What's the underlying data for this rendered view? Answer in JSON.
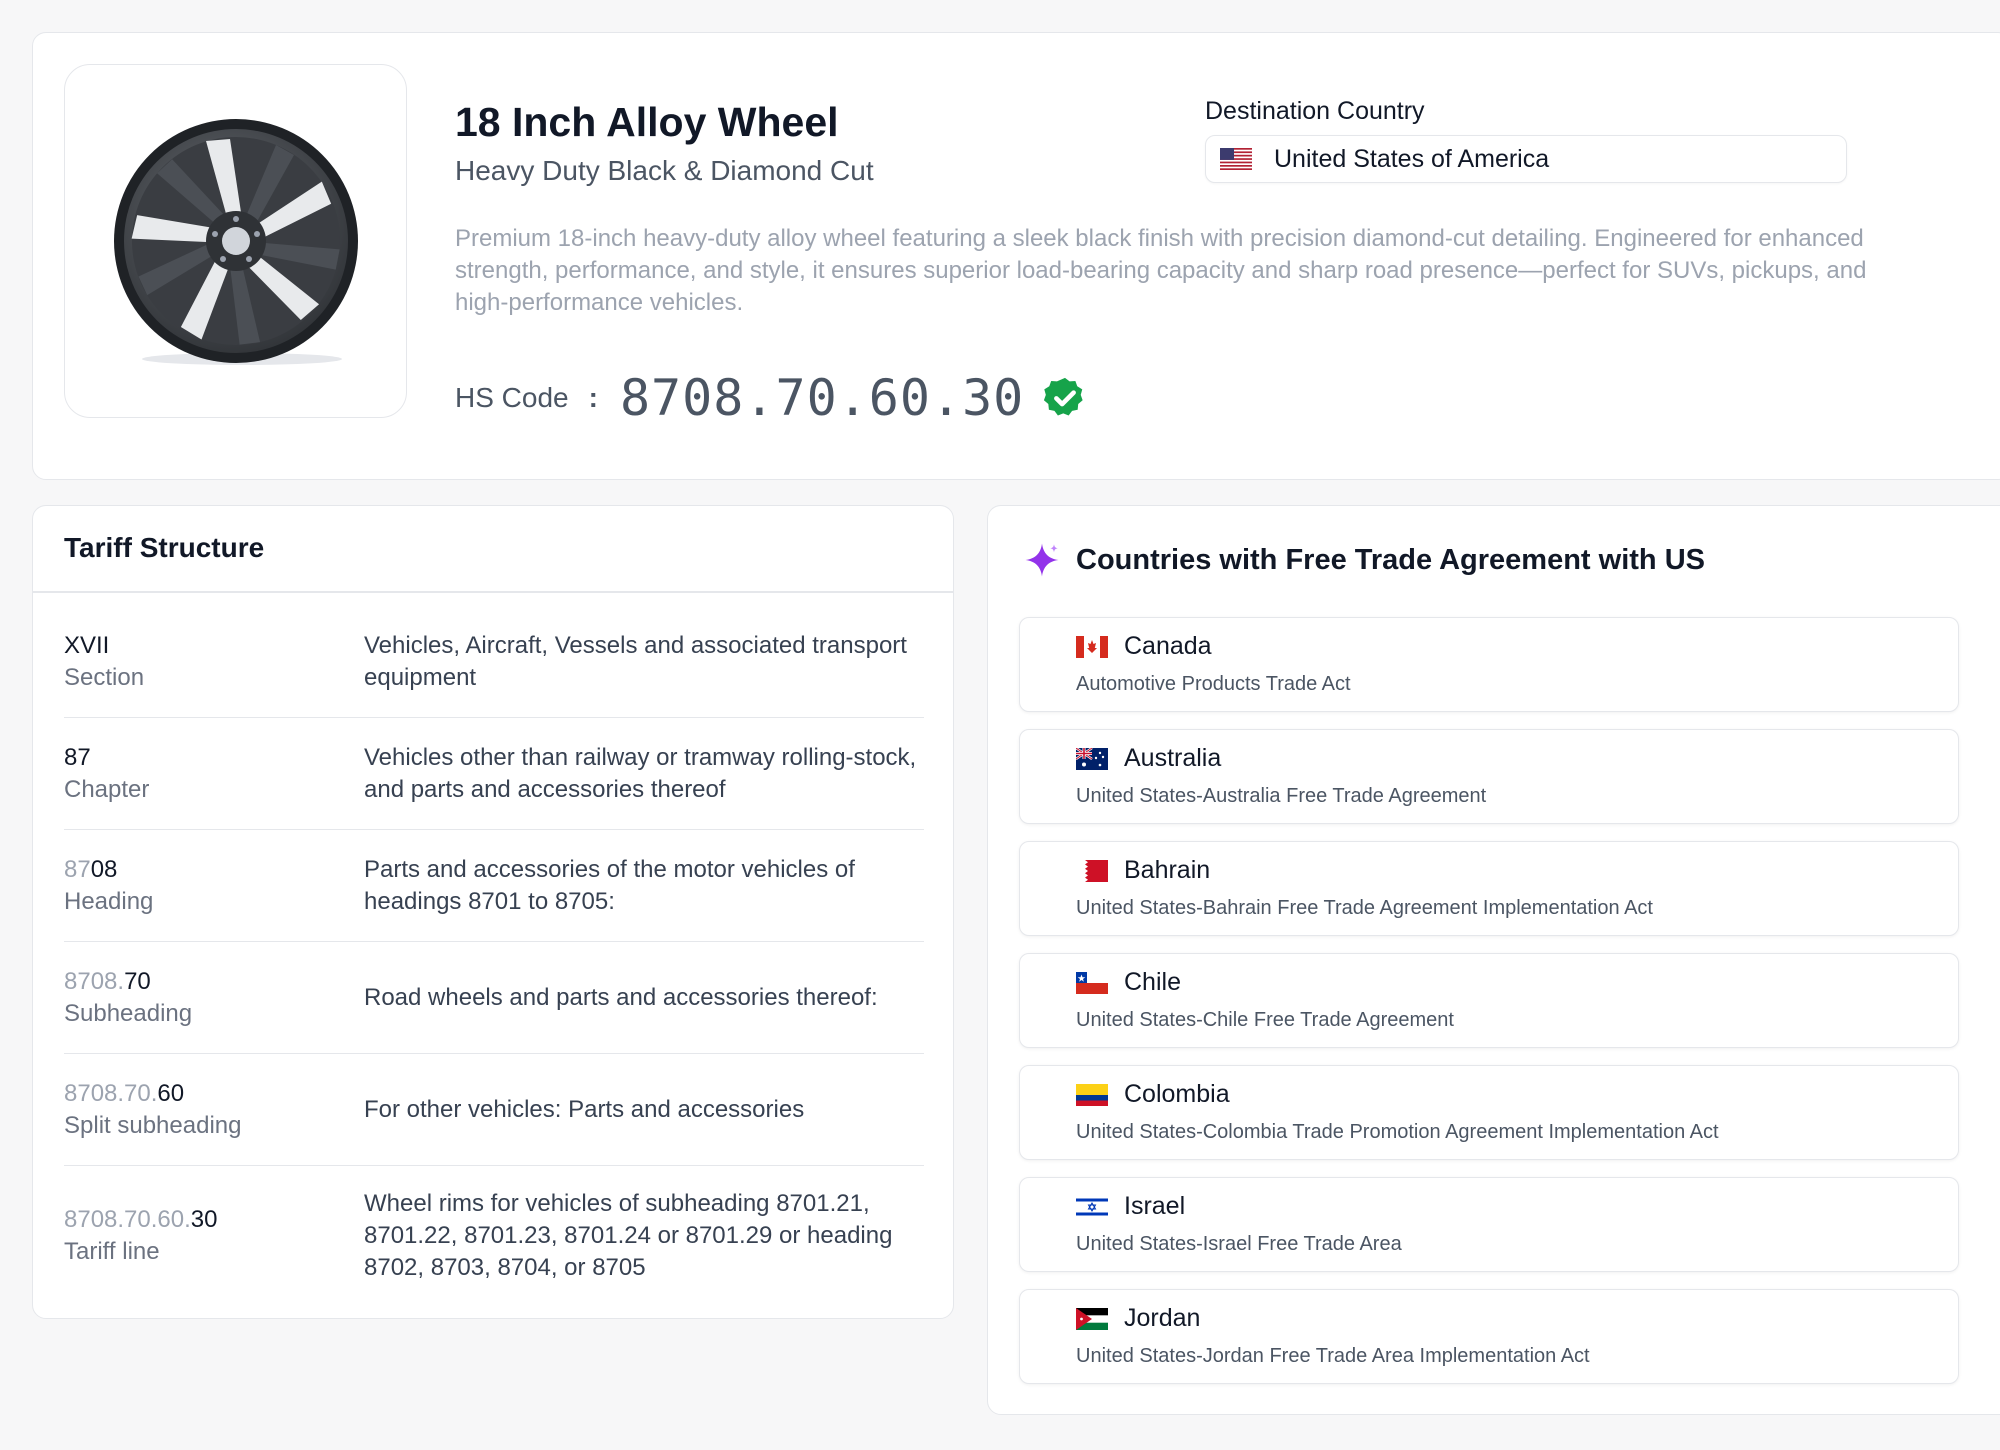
{
  "product": {
    "title": "18 Inch Alloy Wheel",
    "subtitle": "Heavy Duty Black & Diamond Cut",
    "description": "Premium 18-inch heavy-duty alloy wheel featuring a sleek black finish with precision diamond-cut detailing. Engineered for enhanced strength, performance, and style, it ensures superior load-bearing capacity and sharp road presence—perfect for SUVs, pickups, and high-performance vehicles.",
    "hs_label": "HS Code",
    "hs_colon": ":",
    "hs_code": "8708.70.60.30",
    "image_icon": "alloy-wheel",
    "verified_icon": "verified-check-icon",
    "verified_color": "#16a34a"
  },
  "destination": {
    "label": "Destination Country",
    "value": "United States of America",
    "flag": "us-flag"
  },
  "tariff": {
    "title": "Tariff Structure",
    "rows": [
      {
        "code_muted": "",
        "code_strong": "XVII",
        "level": "Section",
        "description": "Vehicles, Aircraft, Vessels and associated transport equipment"
      },
      {
        "code_muted": "",
        "code_strong": "87",
        "level": "Chapter",
        "description": "Vehicles other than railway or tramway rolling-stock, and parts and accessories thereof"
      },
      {
        "code_muted": "87",
        "code_strong": "08",
        "level": "Heading",
        "description": "Parts and accessories of the motor vehicles of headings 8701 to 8705:"
      },
      {
        "code_muted": "8708.",
        "code_strong": "70",
        "level": "Subheading",
        "description": "Road wheels and parts and accessories thereof:"
      },
      {
        "code_muted": "8708.70.",
        "code_strong": "60",
        "level": "Split subheading",
        "description": "For other vehicles: Parts and accessories"
      },
      {
        "code_muted": "8708.70.60.",
        "code_strong": "30",
        "level": "Tariff line",
        "description": "Wheel rims for vehicles of subheading 8701.21, 8701.22, 8701.23, 8701.24 or 8701.29 or heading 8702, 8703, 8704, or 8705"
      }
    ]
  },
  "fta": {
    "title": "Countries with Free Trade Agreement with US",
    "icon": "sparkle-icon",
    "accent": "#9333ea",
    "items": [
      {
        "country": "Canada",
        "agreement": "Automotive Products Trade Act",
        "flag": "canada-flag"
      },
      {
        "country": "Australia",
        "agreement": "United States-Australia Free Trade Agreement",
        "flag": "australia-flag"
      },
      {
        "country": "Bahrain",
        "agreement": "United States-Bahrain Free Trade Agreement Implementation Act",
        "flag": "bahrain-flag"
      },
      {
        "country": "Chile",
        "agreement": "United States-Chile Free Trade Agreement",
        "flag": "chile-flag"
      },
      {
        "country": "Colombia",
        "agreement": "United States-Colombia Trade Promotion Agreement Implementation Act",
        "flag": "colombia-flag"
      },
      {
        "country": "Israel",
        "agreement": "United States-Israel Free Trade Area",
        "flag": "israel-flag"
      },
      {
        "country": "Jordan",
        "agreement": "United States-Jordan Free Trade Area Implementation Act",
        "flag": "jordan-flag"
      }
    ]
  }
}
